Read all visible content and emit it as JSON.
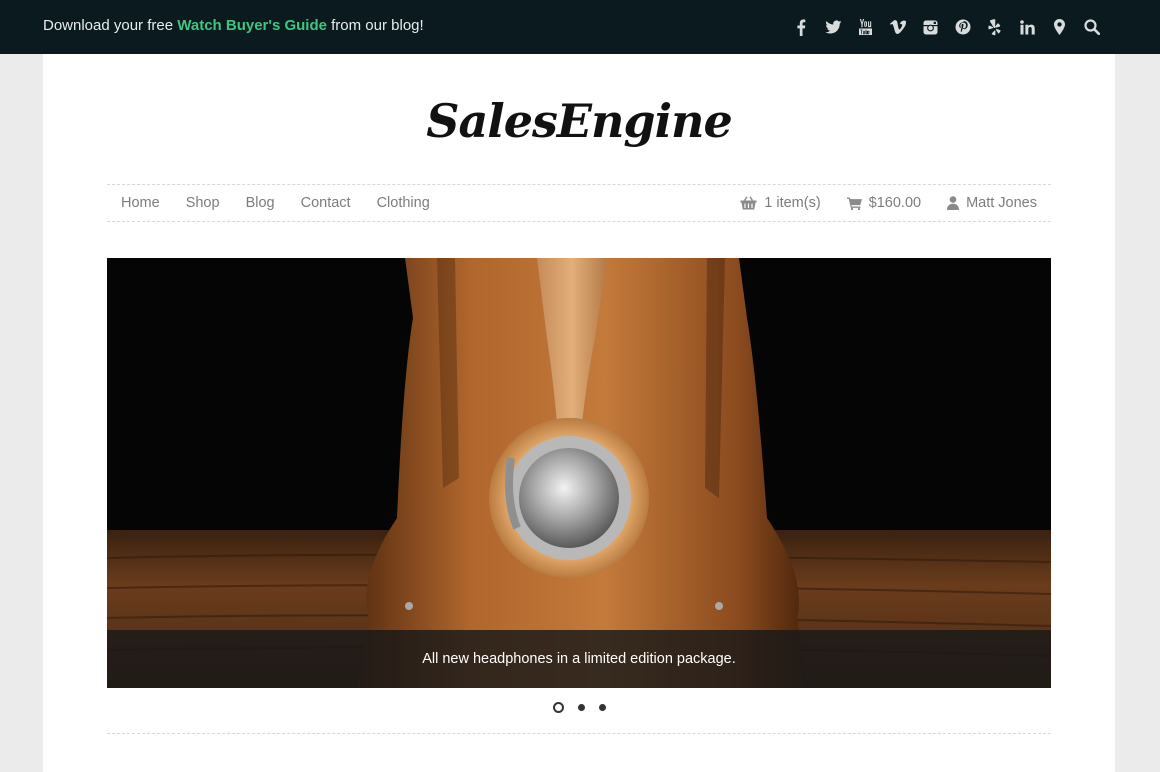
{
  "topbar": {
    "promo_before": "Download your free ",
    "promo_link": "Watch Buyer's Guide",
    "promo_after": " from our blog!",
    "link_color": "#3ec67c",
    "social_icons": [
      "facebook-icon",
      "twitter-icon",
      "youtube-icon",
      "vimeo-icon",
      "instagram-icon",
      "pinterest-icon",
      "yelp-icon",
      "linkedin-icon",
      "map-marker-icon",
      "search-icon"
    ]
  },
  "logo": {
    "text": "SalesEngine"
  },
  "nav": {
    "items": [
      "Home",
      "Shop",
      "Blog",
      "Contact",
      "Clothing"
    ],
    "cart_count": "1 item(s)",
    "cart_total": "$160.00",
    "user_name": "Matt Jones"
  },
  "slider": {
    "caption": "All new headphones in a limited edition package.",
    "slide_count": 3,
    "active_slide": 1
  }
}
